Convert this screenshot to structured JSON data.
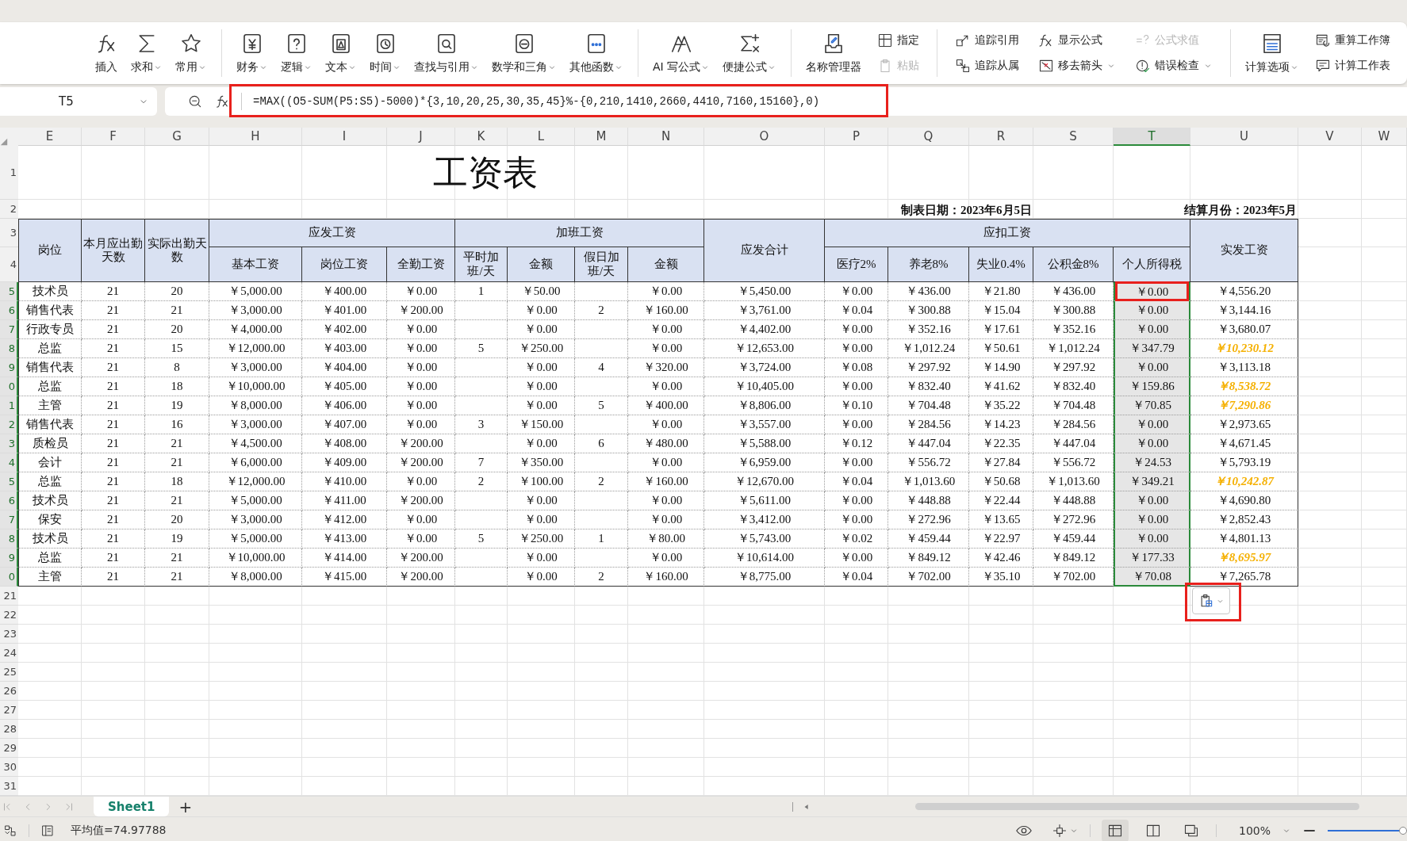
{
  "ribbon": {
    "groups": [
      {
        "items": [
          {
            "kind": "large",
            "label": "插入",
            "dropdown": false,
            "disabled": false
          },
          {
            "kind": "large",
            "label": "求和",
            "dropdown": true,
            "disabled": false
          },
          {
            "kind": "large",
            "label": "常用",
            "dropdown": true,
            "disabled": false
          }
        ]
      },
      {
        "items": [
          {
            "kind": "large",
            "label": "财务",
            "dropdown": true,
            "disabled": false
          },
          {
            "kind": "large",
            "label": "逻辑",
            "dropdown": true,
            "disabled": false
          },
          {
            "kind": "large",
            "label": "文本",
            "dropdown": true,
            "disabled": false
          },
          {
            "kind": "large",
            "label": "时间",
            "dropdown": true,
            "disabled": false
          },
          {
            "kind": "large",
            "label": "查找与引用",
            "dropdown": true,
            "disabled": false
          },
          {
            "kind": "large",
            "label": "数学和三角",
            "dropdown": true,
            "disabled": false
          },
          {
            "kind": "large",
            "label": "其他函数",
            "dropdown": true,
            "disabled": false
          }
        ]
      },
      {
        "items": [
          {
            "kind": "large",
            "label": "AI 写公式",
            "dropdown": true,
            "disabled": false
          },
          {
            "kind": "large",
            "label": "便捷公式",
            "dropdown": true,
            "disabled": false
          }
        ]
      },
      {
        "items": [
          {
            "kind": "large",
            "label": "名称管理器",
            "dropdown": false,
            "disabled": false
          },
          {
            "kind": "small",
            "label": "指定",
            "dropdown": false,
            "disabled": false
          },
          {
            "kind": "small",
            "label": "粘贴",
            "dropdown": false,
            "disabled": true
          }
        ]
      },
      {
        "items": [
          {
            "kind": "small",
            "label": "追踪引用",
            "dropdown": false,
            "disabled": false
          },
          {
            "kind": "small",
            "label": "追踪从属",
            "dropdown": false,
            "disabled": false
          },
          {
            "kind": "small",
            "label": "显示公式",
            "dropdown": false,
            "disabled": false
          },
          {
            "kind": "small",
            "label": "移去箭头",
            "dropdown": true,
            "disabled": false
          },
          {
            "kind": "small",
            "label": "公式求值",
            "dropdown": false,
            "disabled": true
          },
          {
            "kind": "small",
            "label": "错误检查",
            "dropdown": true,
            "disabled": false
          }
        ]
      },
      {
        "items": [
          {
            "kind": "large",
            "label": "计算选项",
            "dropdown": true,
            "disabled": false
          },
          {
            "kind": "small",
            "label": "重算工作簿",
            "dropdown": false,
            "disabled": false
          },
          {
            "kind": "small",
            "label": "计算工作表",
            "dropdown": false,
            "disabled": false
          }
        ]
      }
    ]
  },
  "formula_bar": {
    "name_box": "T5",
    "formula": "=MAX((O5-SUM(P5:S5)-5000)*{3,10,20,25,30,35,45}%-{0,210,1410,2660,4410,7160,15160},0)",
    "annotated": true
  },
  "sheet": {
    "columns": [
      {
        "label": "E",
        "selected": false
      },
      {
        "label": "F",
        "selected": false
      },
      {
        "label": "G",
        "selected": false
      },
      {
        "label": "H",
        "selected": false
      },
      {
        "label": "I",
        "selected": false
      },
      {
        "label": "J",
        "selected": false
      },
      {
        "label": "K",
        "selected": false
      },
      {
        "label": "L",
        "selected": false
      },
      {
        "label": "M",
        "selected": false
      },
      {
        "label": "N",
        "selected": false
      },
      {
        "label": "O",
        "selected": false
      },
      {
        "label": "P",
        "selected": false
      },
      {
        "label": "Q",
        "selected": false
      },
      {
        "label": "R",
        "selected": false
      },
      {
        "label": "S",
        "selected": false
      },
      {
        "label": "T",
        "selected": true
      },
      {
        "label": "U",
        "selected": false
      },
      {
        "label": "V",
        "selected": false
      },
      {
        "label": "W",
        "selected": false
      }
    ],
    "top_row_numbers": [
      "1",
      "2",
      "3",
      "4"
    ],
    "title": "工资表",
    "date_note": "制表日期：2023年6月5日",
    "month_note": "结算月份：2023年5月",
    "header": {
      "tall": [
        "岗位",
        "本月应出勤天数",
        "实际出勤天数",
        "应发合计",
        "实发工资"
      ],
      "groups": [
        "应发工资",
        "加班工资",
        "应扣工资"
      ],
      "sub": [
        "基本工资",
        "岗位工资",
        "全勤工资",
        "平时加班/天",
        "金额",
        "假日加班/天",
        "金额",
        "医疗2%",
        "养老8%",
        "失业0.4%",
        "公积金8%",
        "个人所得税"
      ]
    },
    "rows": [
      {
        "number": "5",
        "selected": true,
        "active_annotated": true,
        "net_highlighted": false,
        "cells": [
          "技术员",
          "21",
          "20",
          "￥5,000.00",
          "￥400.00",
          "￥0.00",
          "1",
          "￥50.00",
          null,
          "￥0.00",
          "￥5,450.00",
          "￥0.00",
          "￥436.00",
          "￥21.80",
          "￥436.00",
          "￥0.00",
          "￥4,556.20"
        ]
      },
      {
        "number": "6",
        "selected": true,
        "active_annotated": false,
        "net_highlighted": false,
        "cells": [
          "销售代表",
          "21",
          "21",
          "￥3,000.00",
          "￥401.00",
          "￥200.00",
          null,
          "￥0.00",
          "2",
          "￥160.00",
          "￥3,761.00",
          "￥0.04",
          "￥300.88",
          "￥15.04",
          "￥300.88",
          "￥0.00",
          "￥3,144.16"
        ]
      },
      {
        "number": "7",
        "selected": true,
        "active_annotated": false,
        "net_highlighted": false,
        "cells": [
          "行政专员",
          "21",
          "20",
          "￥4,000.00",
          "￥402.00",
          "￥0.00",
          null,
          "￥0.00",
          null,
          "￥0.00",
          "￥4,402.00",
          "￥0.00",
          "￥352.16",
          "￥17.61",
          "￥352.16",
          "￥0.00",
          "￥3,680.07"
        ]
      },
      {
        "number": "8",
        "selected": true,
        "active_annotated": false,
        "net_highlighted": true,
        "cells": [
          "总监",
          "21",
          "15",
          "￥12,000.00",
          "￥403.00",
          "￥0.00",
          "5",
          "￥250.00",
          null,
          "￥0.00",
          "￥12,653.00",
          "￥0.00",
          "￥1,012.24",
          "￥50.61",
          "￥1,012.24",
          "￥347.79",
          "￥10,230.12"
        ]
      },
      {
        "number": "9",
        "selected": true,
        "active_annotated": false,
        "net_highlighted": false,
        "cells": [
          "销售代表",
          "21",
          "8",
          "￥3,000.00",
          "￥404.00",
          "￥0.00",
          null,
          "￥0.00",
          "4",
          "￥320.00",
          "￥3,724.00",
          "￥0.08",
          "￥297.92",
          "￥14.90",
          "￥297.92",
          "￥0.00",
          "￥3,113.18"
        ]
      },
      {
        "number": "0",
        "selected": true,
        "active_annotated": false,
        "net_highlighted": true,
        "cells": [
          "总监",
          "21",
          "18",
          "￥10,000.00",
          "￥405.00",
          "￥0.00",
          null,
          "￥0.00",
          null,
          "￥0.00",
          "￥10,405.00",
          "￥0.00",
          "￥832.40",
          "￥41.62",
          "￥832.40",
          "￥159.86",
          "￥8,538.72"
        ]
      },
      {
        "number": "1",
        "selected": true,
        "active_annotated": false,
        "net_highlighted": true,
        "cells": [
          "主管",
          "21",
          "19",
          "￥8,000.00",
          "￥406.00",
          "￥0.00",
          null,
          "￥0.00",
          "5",
          "￥400.00",
          "￥8,806.00",
          "￥0.10",
          "￥704.48",
          "￥35.22",
          "￥704.48",
          "￥70.85",
          "￥7,290.86"
        ]
      },
      {
        "number": "2",
        "selected": true,
        "active_annotated": false,
        "net_highlighted": false,
        "cells": [
          "销售代表",
          "21",
          "16",
          "￥3,000.00",
          "￥407.00",
          "￥0.00",
          "3",
          "￥150.00",
          null,
          "￥0.00",
          "￥3,557.00",
          "￥0.00",
          "￥284.56",
          "￥14.23",
          "￥284.56",
          "￥0.00",
          "￥2,973.65"
        ]
      },
      {
        "number": "3",
        "selected": true,
        "active_annotated": false,
        "net_highlighted": false,
        "cells": [
          "质检员",
          "21",
          "21",
          "￥4,500.00",
          "￥408.00",
          "￥200.00",
          null,
          "￥0.00",
          "6",
          "￥480.00",
          "￥5,588.00",
          "￥0.12",
          "￥447.04",
          "￥22.35",
          "￥447.04",
          "￥0.00",
          "￥4,671.45"
        ]
      },
      {
        "number": "4",
        "selected": true,
        "active_annotated": false,
        "net_highlighted": false,
        "cells": [
          "会计",
          "21",
          "21",
          "￥6,000.00",
          "￥409.00",
          "￥200.00",
          "7",
          "￥350.00",
          null,
          "￥0.00",
          "￥6,959.00",
          "￥0.00",
          "￥556.72",
          "￥27.84",
          "￥556.72",
          "￥24.53",
          "￥5,793.19"
        ]
      },
      {
        "number": "5",
        "selected": true,
        "active_annotated": false,
        "net_highlighted": true,
        "cells": [
          "总监",
          "21",
          "18",
          "￥12,000.00",
          "￥410.00",
          "￥0.00",
          "2",
          "￥100.00",
          "2",
          "￥160.00",
          "￥12,670.00",
          "￥0.04",
          "￥1,013.60",
          "￥50.68",
          "￥1,013.60",
          "￥349.21",
          "￥10,242.87"
        ]
      },
      {
        "number": "6",
        "selected": true,
        "active_annotated": false,
        "net_highlighted": false,
        "cells": [
          "技术员",
          "21",
          "21",
          "￥5,000.00",
          "￥411.00",
          "￥200.00",
          null,
          "￥0.00",
          null,
          "￥0.00",
          "￥5,611.00",
          "￥0.00",
          "￥448.88",
          "￥22.44",
          "￥448.88",
          "￥0.00",
          "￥4,690.80"
        ]
      },
      {
        "number": "7",
        "selected": true,
        "active_annotated": false,
        "net_highlighted": false,
        "cells": [
          "保安",
          "21",
          "20",
          "￥3,000.00",
          "￥412.00",
          "￥0.00",
          null,
          "￥0.00",
          null,
          "￥0.00",
          "￥3,412.00",
          "￥0.00",
          "￥272.96",
          "￥13.65",
          "￥272.96",
          "￥0.00",
          "￥2,852.43"
        ]
      },
      {
        "number": "8",
        "selected": true,
        "active_annotated": false,
        "net_highlighted": false,
        "cells": [
          "技术员",
          "21",
          "19",
          "￥5,000.00",
          "￥413.00",
          "￥0.00",
          "5",
          "￥250.00",
          "1",
          "￥80.00",
          "￥5,743.00",
          "￥0.02",
          "￥459.44",
          "￥22.97",
          "￥459.44",
          "￥0.00",
          "￥4,801.13"
        ]
      },
      {
        "number": "9",
        "selected": true,
        "active_annotated": false,
        "net_highlighted": true,
        "cells": [
          "总监",
          "21",
          "21",
          "￥10,000.00",
          "￥414.00",
          "￥200.00",
          null,
          "￥0.00",
          null,
          "￥0.00",
          "￥10,614.00",
          "￥0.00",
          "￥849.12",
          "￥42.46",
          "￥849.12",
          "￥177.33",
          "￥8,695.97"
        ]
      },
      {
        "number": "0",
        "selected": true,
        "active_annotated": false,
        "net_highlighted": false,
        "cells": [
          "主管",
          "21",
          "21",
          "￥8,000.00",
          "￥415.00",
          "￥200.00",
          null,
          "￥0.00",
          "2",
          "￥160.00",
          "￥8,775.00",
          "￥0.04",
          "￥702.00",
          "￥35.10",
          "￥702.00",
          "￥70.08",
          "￥7,265.78"
        ]
      }
    ],
    "bottom_row_numbers": [
      "21",
      "22",
      "23",
      "24",
      "25",
      "26",
      "27",
      "28",
      "29",
      "30",
      "31"
    ],
    "paste_options": {
      "annotated": true
    }
  },
  "sheet_tabs": {
    "tabs": [
      {
        "label": "Sheet1",
        "selected": true
      }
    ],
    "add": "+"
  },
  "status_bar": {
    "summary": "平均值=74.97788",
    "views": [
      {
        "selected": true
      },
      {
        "selected": false
      },
      {
        "selected": false
      }
    ],
    "zoom": "100%",
    "zoom_slider": {
      "level": 0.95
    }
  }
}
